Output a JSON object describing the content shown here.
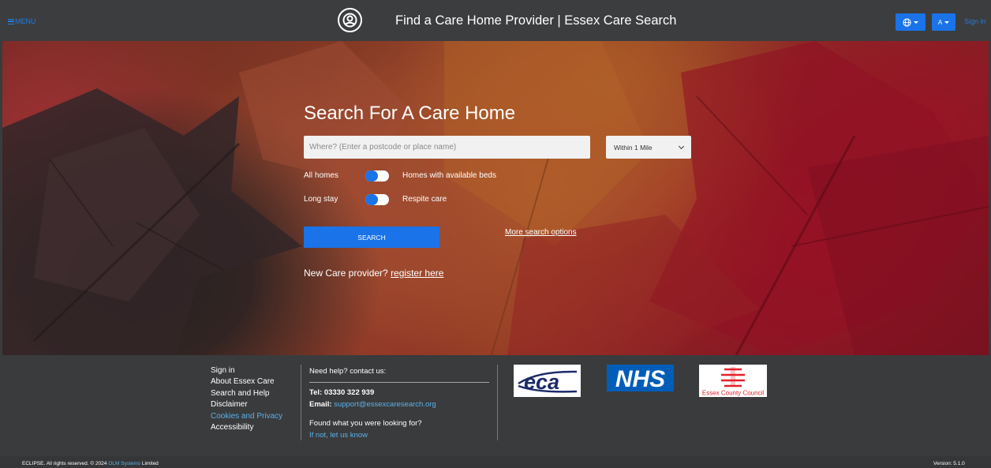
{
  "header": {
    "menu_label": "MENU",
    "site_title": "Find a Care Home Provider | Essex Care Search",
    "font_button_label": "A",
    "sign_in": "Sign in",
    "icons": [
      "menu-icon",
      "care-search-logo-icon",
      "globe-icon",
      "caret-down-icon"
    ]
  },
  "hero": {
    "heading": "Search For A Care Home",
    "search": {
      "placeholder": "Where? (Enter a postcode or place name)",
      "value": ""
    },
    "radius": {
      "selected": "Within 1 Mile"
    },
    "toggles": [
      {
        "left_label": "All homes",
        "right_label": "Homes with available beds"
      },
      {
        "left_label": "Long stay",
        "right_label": "Respite care"
      }
    ],
    "search_button": "SEARCH",
    "more_options": "More search options",
    "new_provider_text": "New Care provider?",
    "register_link": "register here"
  },
  "footer": {
    "links": [
      {
        "label": "Sign in"
      },
      {
        "label": "About Essex Care"
      },
      {
        "label": "Search and Help"
      },
      {
        "label": "Disclaimer"
      },
      {
        "label": "Cookies and Privacy"
      },
      {
        "label": "Accessibility"
      }
    ],
    "help": {
      "title": "Need help? contact us:",
      "tel_label": "Tel:",
      "tel_value": "03330 322 939",
      "email_label": "Email:",
      "email_value": "support@essexcaresearch.org",
      "found_question": "Found what you were looking for?",
      "found_link": "If not, let us know"
    },
    "logos": {
      "eca": "eca",
      "nhs": "NHS",
      "essex": "Essex County Council"
    }
  },
  "bottom": {
    "copyright_prefix": "ECLIPSE. All rights reserved. © 2024",
    "company": "OLM Systems",
    "copyright_suffix": "Limited",
    "version": "Version: 5.1.0"
  },
  "colors": {
    "accent": "#1a73e8",
    "link": "#59b2ea",
    "header_bg": "#3c3d3f",
    "nhs_blue": "#005eb8",
    "essex_red": "#e3202b"
  }
}
